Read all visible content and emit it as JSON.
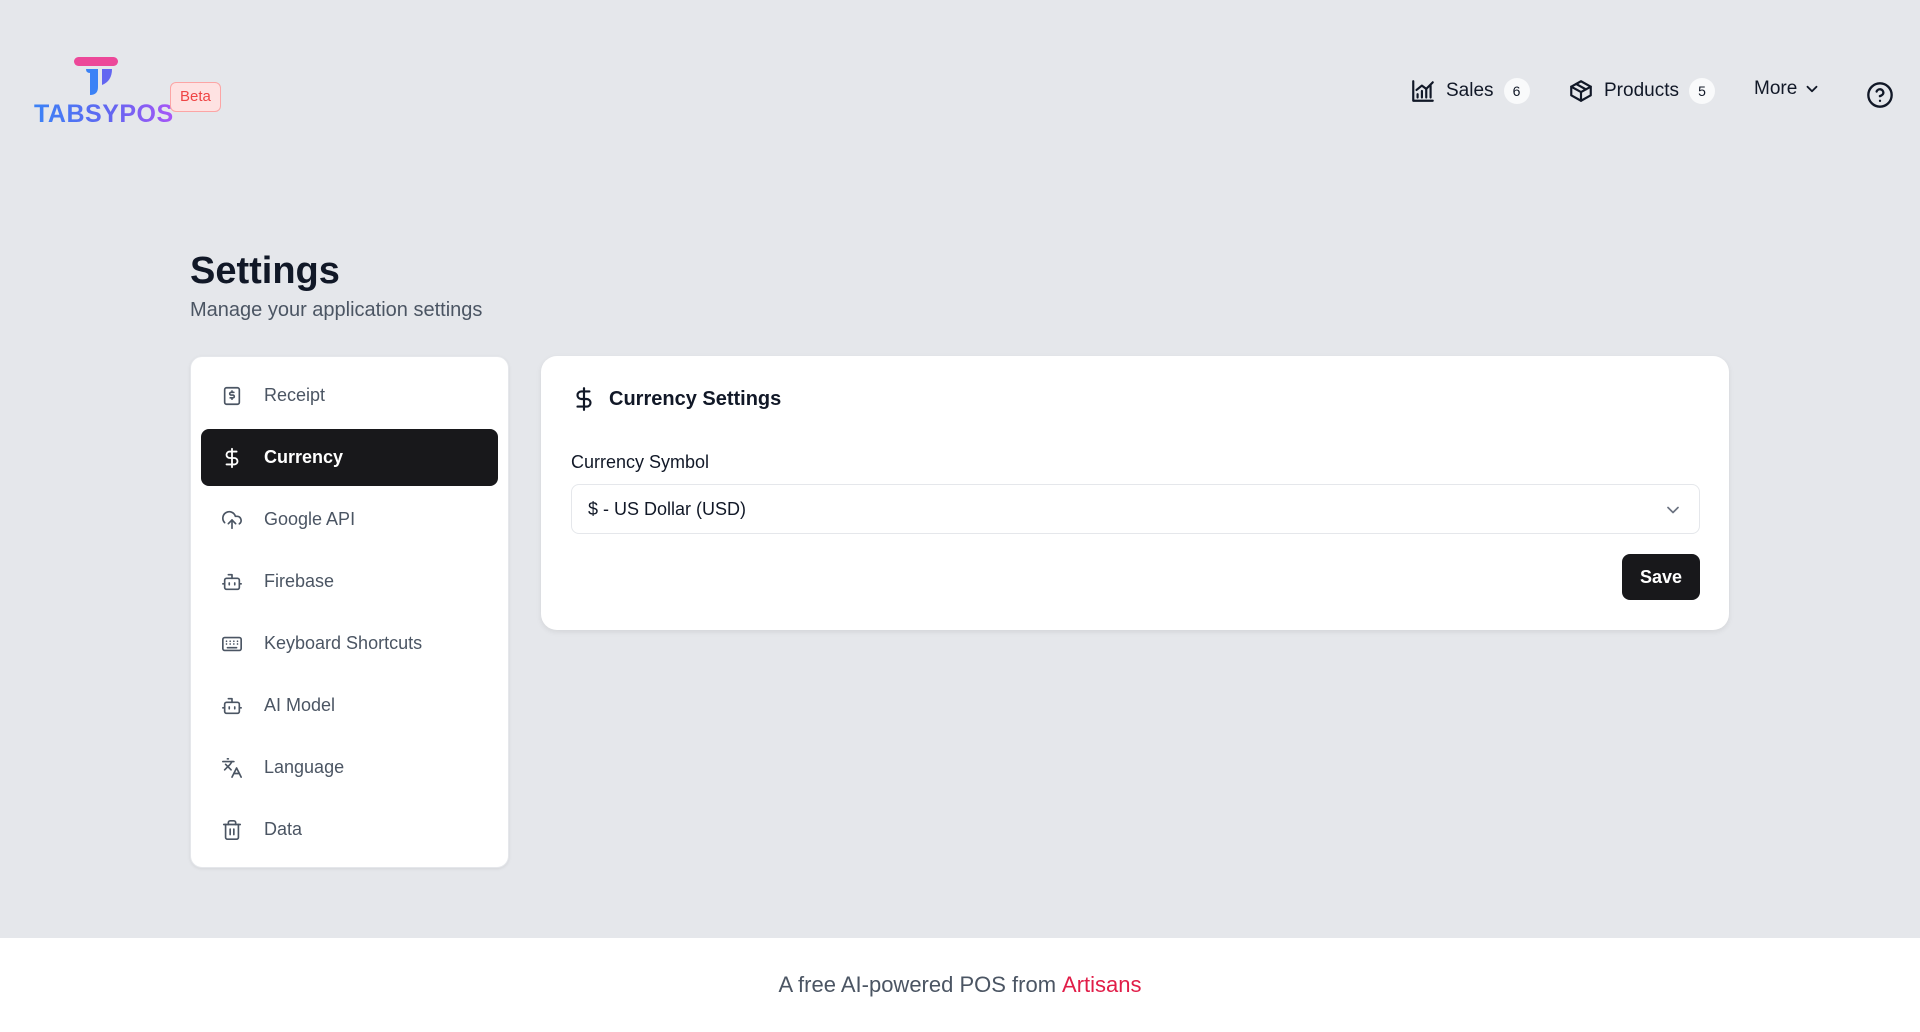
{
  "app": {
    "logo_text": "TABSYPOS",
    "badge": "Beta"
  },
  "nav": {
    "sales": {
      "label": "Sales",
      "count": "6",
      "icon": "chart-icon"
    },
    "products": {
      "label": "Products",
      "count": "5",
      "icon": "package-icon"
    },
    "more": {
      "label": "More",
      "icon": "chevron-down-icon"
    },
    "help_icon": "help-circle-icon"
  },
  "page": {
    "title": "Settings",
    "subtitle": "Manage your application settings"
  },
  "sidebar": {
    "items": [
      {
        "label": "Receipt",
        "icon": "receipt-icon",
        "active": false
      },
      {
        "label": "Currency",
        "icon": "dollar-icon",
        "active": true
      },
      {
        "label": "Google API",
        "icon": "cloud-upload-icon",
        "active": false
      },
      {
        "label": "Firebase",
        "icon": "bot-icon",
        "active": false
      },
      {
        "label": "Keyboard Shortcuts",
        "icon": "keyboard-icon",
        "active": false
      },
      {
        "label": "AI Model",
        "icon": "bot-icon",
        "active": false
      },
      {
        "label": "Language",
        "icon": "languages-icon",
        "active": false
      },
      {
        "label": "Data",
        "icon": "trash-icon",
        "active": false
      }
    ]
  },
  "panel": {
    "title": "Currency Settings",
    "field_label": "Currency Symbol",
    "selected_value": "$ - US Dollar (USD)",
    "save_label": "Save"
  },
  "footer": {
    "text": "A free AI-powered POS from",
    "brand": "Artisans"
  },
  "colors": {
    "background": "#e5e7eb",
    "active_item": "#18181b",
    "brand_accent": "#e11d48",
    "logo_pink": "#ec4899",
    "logo_blue": "#3b82f6",
    "beta_bg": "#fee2e2",
    "beta_text": "#ef4444"
  }
}
